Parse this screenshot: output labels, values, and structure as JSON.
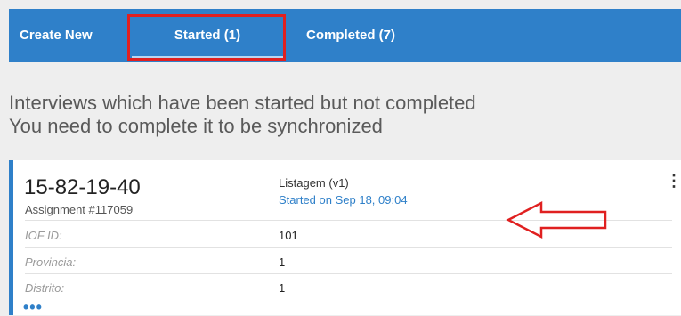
{
  "tabs": {
    "create_new": "Create New",
    "started": "Started (1)",
    "completed": "Completed (7)"
  },
  "intro": {
    "line1": "Interviews which have been started but not completed",
    "line2": "You need to complete it to be synchronized"
  },
  "card": {
    "key": "15-82-19-40",
    "assignment": "Assignment #117059",
    "questionnaire": "Listagem (v1)",
    "started_on": "Started on Sep 18, 09:04",
    "menu_icon": "⋮",
    "more_icon": "•••",
    "fields": [
      {
        "label": "IOF ID:",
        "value": "101"
      },
      {
        "label": "Provincia:",
        "value": "1"
      },
      {
        "label": "Distrito:",
        "value": "1"
      }
    ]
  },
  "colors": {
    "tab_bar": "#2f80c9",
    "highlight": "#e02020",
    "accent": "#2f80c9"
  }
}
